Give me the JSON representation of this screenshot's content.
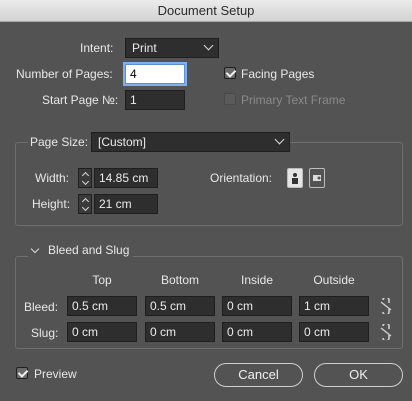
{
  "window": {
    "title": "Document Setup"
  },
  "intent": {
    "label": "Intent:",
    "value": "Print"
  },
  "pages": {
    "num_label": "Number of Pages:",
    "num_value": "4",
    "start_label": "Start Page №:",
    "start_value": "1",
    "facing_label": "Facing Pages",
    "facing_checked": true,
    "primary_label": "Primary Text Frame",
    "primary_checked": false
  },
  "page_size": {
    "label": "Page Size:",
    "value": "[Custom]",
    "width_label": "Width:",
    "width_value": "14.85 cm",
    "height_label": "Height:",
    "height_value": "21 cm",
    "orientation_label": "Orientation:"
  },
  "bleed_slug": {
    "title": "Bleed and Slug",
    "columns": [
      "Top",
      "Bottom",
      "Inside",
      "Outside"
    ],
    "bleed_label": "Bleed:",
    "bleed": [
      "0.5 cm",
      "0.5 cm",
      "0 cm",
      "1 cm"
    ],
    "slug_label": "Slug:",
    "slug": [
      "0 cm",
      "0 cm",
      "0 cm",
      "0 cm"
    ]
  },
  "footer": {
    "preview_label": "Preview",
    "preview_checked": true,
    "cancel": "Cancel",
    "ok": "OK"
  }
}
